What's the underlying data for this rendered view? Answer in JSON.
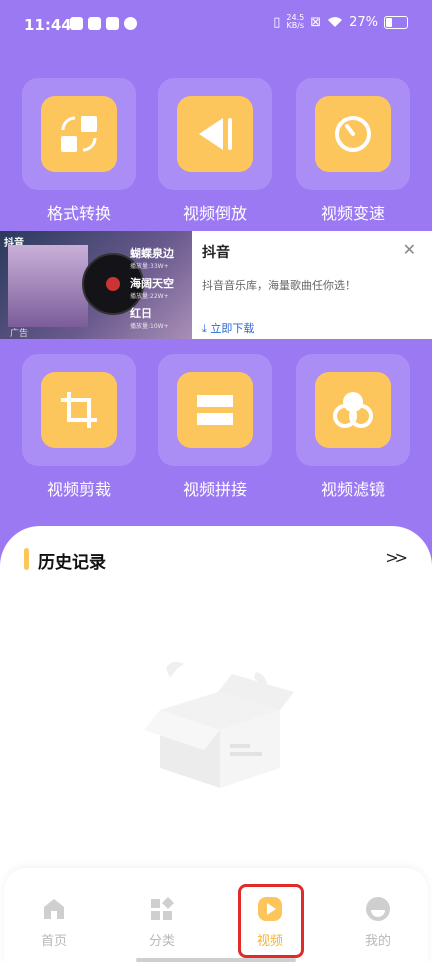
{
  "status_bar": {
    "time": "11:44",
    "net_speed_value": "24.5",
    "net_speed_unit": "KB/s",
    "battery": "27%"
  },
  "tools": [
    {
      "label": "格式转换",
      "icon": "format-convert-icon"
    },
    {
      "label": "视频倒放",
      "icon": "reverse-play-icon"
    },
    {
      "label": "视频变速",
      "icon": "speed-dial-icon"
    },
    {
      "label": "视频剪裁",
      "icon": "crop-icon"
    },
    {
      "label": "视频拼接",
      "icon": "splice-icon"
    },
    {
      "label": "视频滤镜",
      "icon": "filter-icon"
    }
  ],
  "ad": {
    "brand": "抖音",
    "title": "抖音",
    "description": "抖音音乐库，海量歌曲任你选！",
    "download": "立即下载",
    "tag": "广告",
    "songs": [
      {
        "name": "蝴蝶泉边",
        "plays": "播放量:33W+"
      },
      {
        "name": "海阔天空",
        "plays": "播放量:22W+"
      },
      {
        "name": "红日",
        "plays": "播放量:10W+"
      }
    ]
  },
  "history": {
    "title": "历史记录",
    "more": ">>"
  },
  "nav": {
    "items": [
      {
        "label": "首页",
        "icon": "home-icon"
      },
      {
        "label": "分类",
        "icon": "category-icon"
      },
      {
        "label": "视频",
        "icon": "video-play-icon"
      },
      {
        "label": "我的",
        "icon": "profile-icon"
      }
    ],
    "active_index": 2
  },
  "colors": {
    "background": "#9b79f3",
    "accent": "#fdc65c",
    "active_nav": "#f5b532",
    "highlight": "#e02b2b"
  }
}
